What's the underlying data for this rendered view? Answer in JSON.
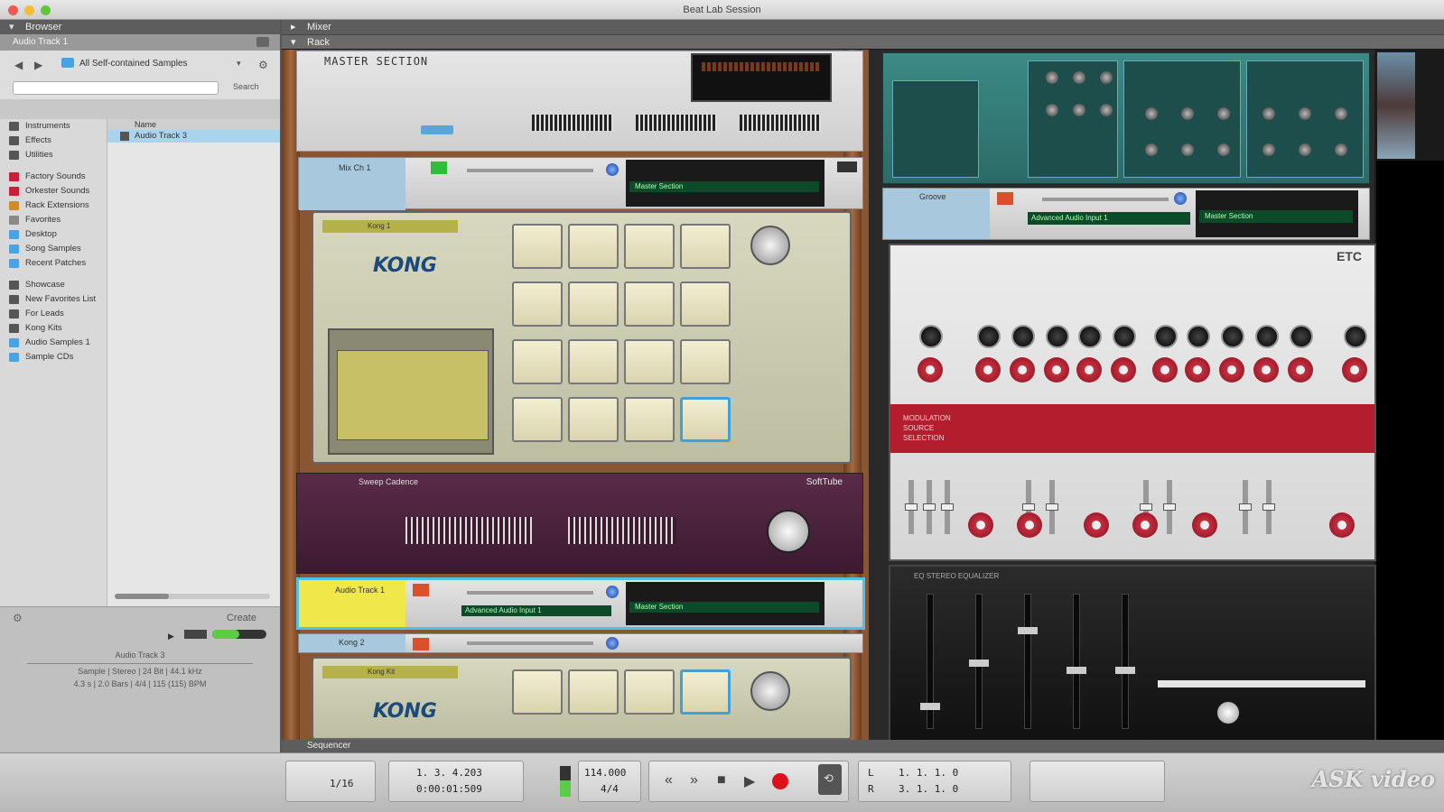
{
  "window": {
    "title": "Beat Lab Session"
  },
  "browser": {
    "header": "Browser",
    "track_label": "Audio Track 1",
    "location": "All Self-contained Samples",
    "search_button": "Search",
    "search_placeholder": "",
    "items": [
      {
        "label": "Instruments",
        "icon": "instrument-icon",
        "color": "#555"
      },
      {
        "label": "Effects",
        "icon": "effects-icon",
        "color": "#555"
      },
      {
        "label": "Utilities",
        "icon": "utilities-icon",
        "color": "#555"
      },
      {
        "label": "Factory Sounds",
        "icon": "factory-icon",
        "color": "#c8203a"
      },
      {
        "label": "Orkester Sounds",
        "icon": "orkester-icon",
        "color": "#c8203a"
      },
      {
        "label": "Rack Extensions",
        "icon": "rack-ext-icon",
        "color": "#d08a2a"
      },
      {
        "label": "Favorites",
        "icon": "favorites-icon",
        "color": "#888"
      },
      {
        "label": "Desktop",
        "icon": "desktop-icon",
        "color": "#4aa3e0"
      },
      {
        "label": "Song Samples",
        "icon": "samples-icon",
        "color": "#4aa3e0"
      },
      {
        "label": "Recent Patches",
        "icon": "recent-icon",
        "color": "#4aa3e0"
      },
      {
        "label": "Showcase",
        "icon": "list-icon",
        "color": "#555"
      },
      {
        "label": "New Favorites List",
        "icon": "list-icon",
        "color": "#555"
      },
      {
        "label": "For Leads",
        "icon": "list-icon",
        "color": "#555"
      },
      {
        "label": "Kong Kits",
        "icon": "list-icon",
        "color": "#555"
      },
      {
        "label": "Audio Samples 1",
        "icon": "folder-icon",
        "color": "#4aa3e0"
      },
      {
        "label": "Sample CDs",
        "icon": "folder-icon",
        "color": "#4aa3e0"
      }
    ],
    "files_header": "Name",
    "file_selected": "Audio Track 3",
    "create_label": "Create",
    "footer_name": "Audio Track 3",
    "footer_info_1": "Sample | Stereo | 24 Bit | 44.1 kHz",
    "footer_info_2": "4.3 s | 2.0 Bars | 4/4 | 115 (115) BPM"
  },
  "mixer": {
    "header": "Mixer"
  },
  "rack": {
    "header": "Rack",
    "master_title": "MASTER SECTION",
    "strips": [
      {
        "name": "Mix Ch 1",
        "display": "Master Section"
      },
      {
        "name": "Groove",
        "display": "Master Section",
        "input": "Advanced Audio Input 1"
      },
      {
        "name": "Audio Track 1",
        "display": "Master Section",
        "input": "Advanced Audio Input 1"
      },
      {
        "name": "Kong 2",
        "display": ""
      }
    ],
    "kong": [
      {
        "logo": "KONG",
        "patch": "Kong 1"
      },
      {
        "logo": "KONG",
        "patch": "Kong Kit"
      }
    ],
    "compressor": {
      "name": "Sweep Cadence",
      "brand": "SoftTube"
    },
    "etc": {
      "title": "ETC",
      "mod_label": "MODULATION SOURCE SELECTION"
    },
    "eq": {
      "title": "EQ STEREO EQUALIZER"
    }
  },
  "sequencer": {
    "header": "Sequencer"
  },
  "transport": {
    "time_sig": "1/16",
    "position": "1. 3. 4.203",
    "time": "0:00:01:509",
    "tempo": "114.000",
    "signature": "4/4",
    "left_loc": "1. 1. 1. 0",
    "right_loc": "3. 1. 1. 0",
    "L": "L",
    "R": "R"
  },
  "watermark": "ASK video",
  "colors": {
    "accent_blue": "#4cc3e6",
    "record_red": "#e0101a",
    "etc_red": "#b31d2e",
    "synth_teal": "#3c8a86"
  }
}
